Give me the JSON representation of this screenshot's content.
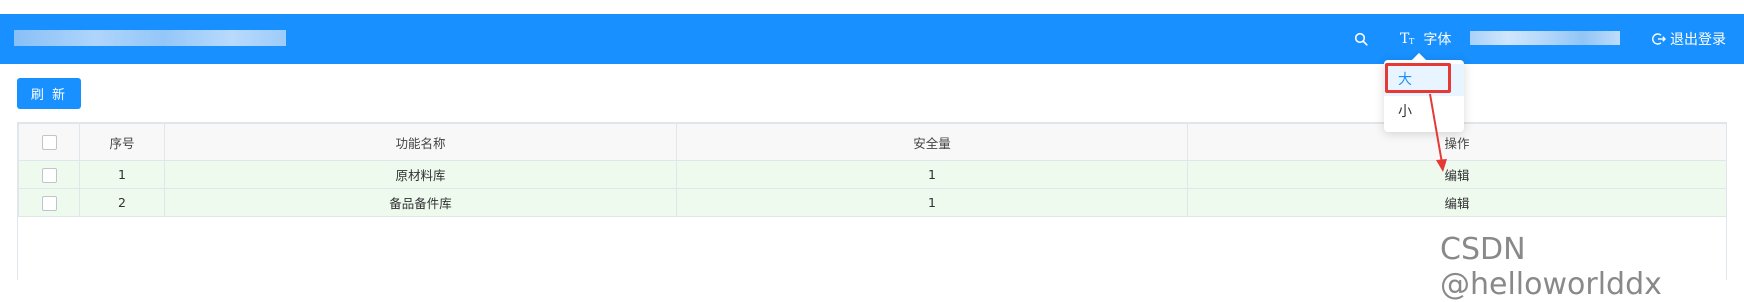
{
  "header": {
    "font_label": "字体",
    "logout_label": "退出登录",
    "search_icon": "search-icon",
    "font_icon": "font-size-icon",
    "logout_icon": "logout-icon",
    "background_color": "#1890ff"
  },
  "toolbar": {
    "refresh_label": "刷 新"
  },
  "table": {
    "columns": [
      "",
      "序号",
      "功能名称",
      "安全量",
      "操作"
    ],
    "rows": [
      {
        "index": "1",
        "name": "原材料库",
        "safety_stock": "1",
        "action": "编辑"
      },
      {
        "index": "2",
        "name": "备品备件库",
        "safety_stock": "1",
        "action": "编辑"
      }
    ],
    "row_highlight_color": "#effaef"
  },
  "font_dropdown": {
    "options": [
      "大",
      "小"
    ],
    "selected": "大"
  },
  "annotation": {
    "highlight_color": "#e53935"
  },
  "watermark": {
    "text": "CSDN @helloworlddx"
  }
}
